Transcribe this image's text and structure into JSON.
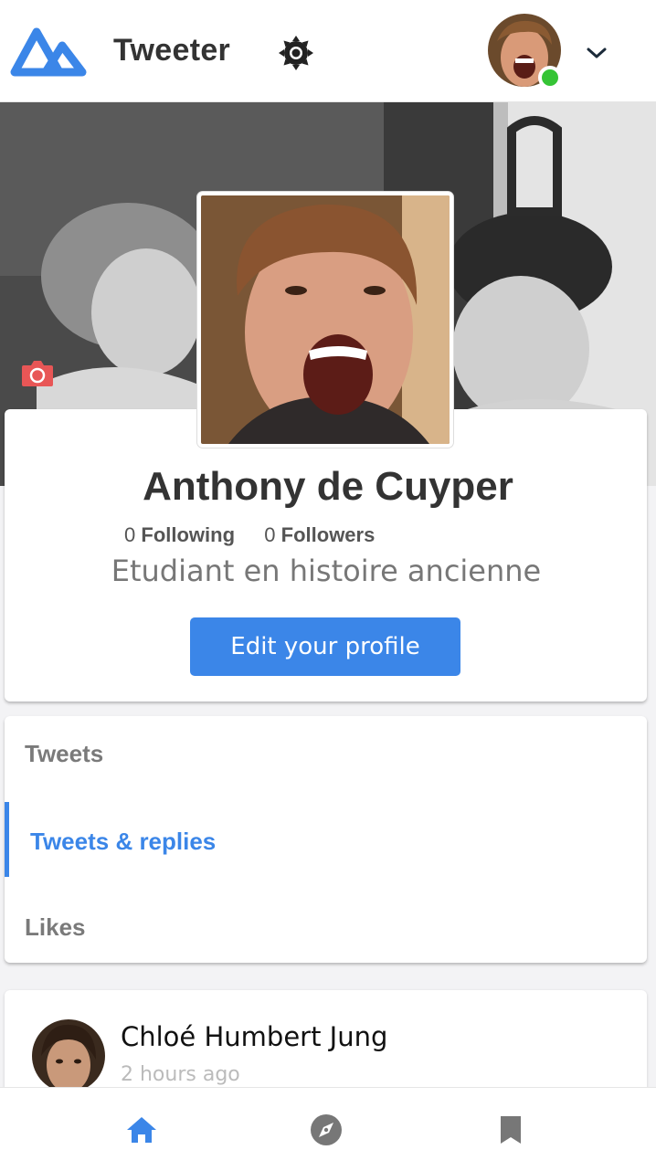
{
  "app": {
    "brand": "Tweeter",
    "accent_color": "#3b86e8",
    "online_color": "#35c435"
  },
  "header": {
    "logo_icon": "tweeter-logo-icon",
    "theme_icon": "brightness-icon",
    "menu_icon": "chevron-down-icon",
    "user_online": true
  },
  "cover": {
    "camera_icon": "camera-icon"
  },
  "profile": {
    "name": "Anthony de Cuyper",
    "following_count": "0",
    "following_label": "Following",
    "followers_count": "0",
    "followers_label": "Followers",
    "bio": "Etudiant en histoire ancienne",
    "edit_button": "Edit your profile"
  },
  "tabs": [
    {
      "label": "Tweets",
      "active": false
    },
    {
      "label": "Tweets & replies",
      "active": true
    },
    {
      "label": "Likes",
      "active": false
    }
  ],
  "tweets": [
    {
      "author": "Chloé Humbert Jung",
      "time": "2 hours ago"
    }
  ],
  "bottom_nav": [
    {
      "icon": "home-icon",
      "active": true
    },
    {
      "icon": "explore-icon",
      "active": false
    },
    {
      "icon": "bookmark-icon",
      "active": false
    }
  ]
}
